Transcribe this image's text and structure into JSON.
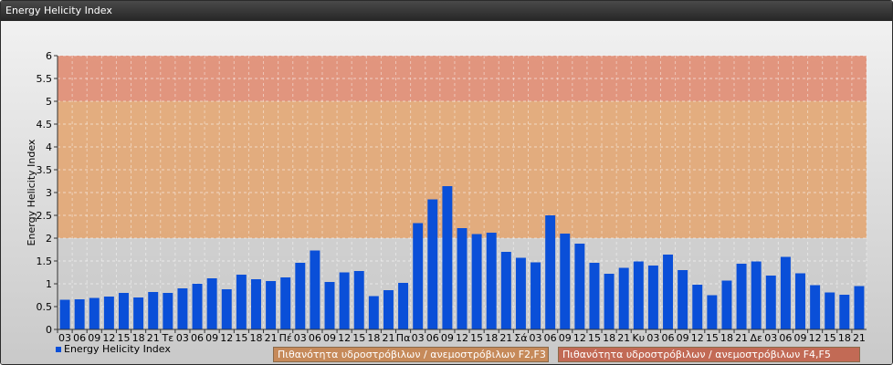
{
  "window": {
    "title": "Energy Helicity Index"
  },
  "chart_data": {
    "type": "bar",
    "ylabel": "Energy Helicity Index",
    "ylim": [
      0,
      6
    ],
    "yticks": [
      "0",
      "0.5",
      "1",
      "1.5",
      "2",
      "2.5",
      "3",
      "3.5",
      "4",
      "4.5",
      "5",
      "5.5",
      "6"
    ],
    "grid": true,
    "bands": [
      {
        "from": 2,
        "to": 5,
        "color": "#e2a673",
        "label": "Πιθανότητα υδροστρόβιλων / ανεμοστρόβιλων F2,F3"
      },
      {
        "from": 5,
        "to": 6,
        "color": "#e08c72",
        "label": "Πιθανότητα υδροστρόβιλων / ανεμοστρόβιλων F4,F5"
      }
    ],
    "categories": [
      "03",
      "06",
      "09",
      "12",
      "15",
      "18",
      "21",
      "Τε",
      "03",
      "06",
      "09",
      "12",
      "15",
      "18",
      "21",
      "Πέ",
      "03",
      "06",
      "09",
      "12",
      "15",
      "18",
      "21",
      "Πα",
      "03",
      "06",
      "09",
      "12",
      "15",
      "18",
      "21",
      "Σά",
      "03",
      "06",
      "09",
      "12",
      "15",
      "18",
      "21",
      "Κυ",
      "03",
      "06",
      "09",
      "12",
      "15",
      "18",
      "21",
      "Δε",
      "03",
      "06",
      "09",
      "12",
      "15",
      "18",
      "21"
    ],
    "series": [
      {
        "name": "Energy Helicity Index",
        "color": "#0a4fd8",
        "values": [
          0.65,
          0.66,
          0.69,
          0.72,
          0.8,
          0.7,
          0.82,
          0.8,
          0.9,
          1.0,
          1.12,
          0.88,
          1.2,
          1.1,
          1.06,
          1.14,
          1.46,
          1.73,
          1.04,
          1.25,
          1.28,
          0.73,
          0.86,
          1.02,
          2.33,
          2.85,
          3.14,
          2.22,
          2.09,
          2.12,
          1.7,
          1.57,
          1.47,
          2.5,
          2.1,
          1.88,
          1.46,
          1.22,
          1.35,
          1.49,
          1.4,
          1.64,
          1.3,
          0.98,
          0.75,
          1.07,
          1.44,
          1.49,
          1.18,
          1.59,
          1.23,
          0.97,
          0.81,
          0.76,
          0.95
        ]
      }
    ],
    "legend_position": "bottom-left"
  }
}
